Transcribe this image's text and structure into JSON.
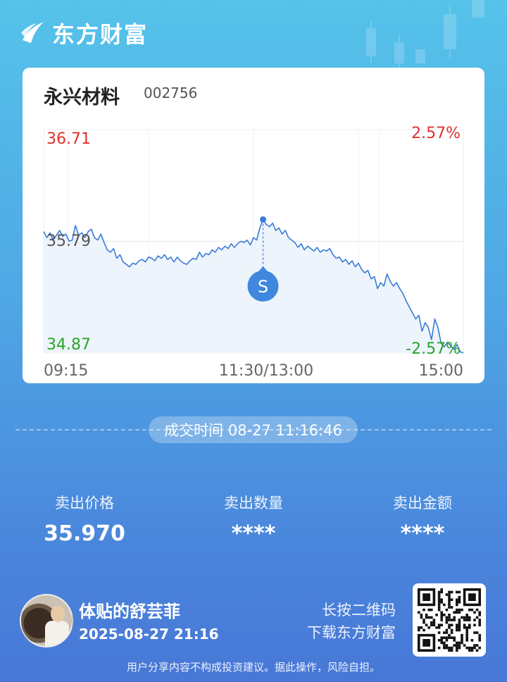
{
  "brand": {
    "name": "东方财富"
  },
  "stock": {
    "name": "永兴材料",
    "code": "002756"
  },
  "chart_data": {
    "type": "line",
    "y_high_label": "36.71",
    "y_mid_label": "35.79",
    "y_low_label": "34.87",
    "pct_high_label": "2.57%",
    "pct_low_label": "-2.57%",
    "x_labels": [
      "09:15",
      "11:30/13:00",
      "15:00"
    ],
    "ylim": [
      34.87,
      36.71
    ],
    "prev_close": 35.79,
    "marker": {
      "label": "S",
      "index": 69,
      "value": 35.97
    },
    "up_color": "#e03030",
    "down_color": "#2aa52a",
    "line_color": "#3a7dd6",
    "series": [
      {
        "values": [
          35.87,
          35.82,
          35.86,
          35.8,
          35.84,
          35.88,
          35.83,
          35.85,
          35.79,
          35.8,
          35.92,
          35.84,
          35.86,
          35.82,
          35.87,
          35.89,
          35.82,
          35.8,
          35.85,
          35.78,
          35.72,
          35.7,
          35.73,
          35.65,
          35.68,
          35.62,
          35.6,
          35.58,
          35.61,
          35.6,
          35.63,
          35.64,
          35.62,
          35.66,
          35.65,
          35.63,
          35.67,
          35.65,
          35.68,
          35.64,
          35.66,
          35.62,
          35.66,
          35.63,
          35.61,
          35.6,
          35.63,
          35.65,
          35.64,
          35.7,
          35.66,
          35.69,
          35.68,
          35.72,
          35.7,
          35.74,
          35.72,
          35.75,
          35.73,
          35.77,
          35.74,
          35.77,
          35.79,
          35.78,
          35.8,
          35.76,
          35.82,
          35.8,
          35.9,
          35.97,
          35.93,
          35.91,
          35.94,
          35.88,
          35.9,
          35.85,
          35.88,
          35.82,
          35.8,
          35.78,
          35.74,
          35.77,
          35.72,
          35.75,
          35.73,
          35.71,
          35.74,
          35.7,
          35.72,
          35.71,
          35.73,
          35.68,
          35.65,
          35.66,
          35.62,
          35.64,
          35.6,
          35.63,
          35.58,
          35.61,
          35.56,
          35.53,
          35.55,
          35.48,
          35.5,
          35.4,
          35.45,
          35.42,
          35.52,
          35.46,
          35.42,
          35.45,
          35.4,
          35.36,
          35.3,
          35.25,
          35.2,
          35.15,
          35.18,
          35.05,
          35.12,
          35.08,
          34.98,
          35.15,
          35.08,
          34.95,
          34.92,
          34.96,
          34.93,
          34.9,
          34.94,
          34.88,
          34.87
        ]
      }
    ]
  },
  "trade": {
    "time_label": "成交时间 08-27 11:16:46"
  },
  "stats": [
    {
      "label": "卖出价格",
      "value": "35.970"
    },
    {
      "label": "卖出数量",
      "value": "****"
    },
    {
      "label": "卖出金额",
      "value": "****"
    }
  ],
  "user": {
    "name": "体贴的舒芸菲",
    "time": "2025-08-27 21:16"
  },
  "qr": {
    "hint_line1": "长按二维码",
    "hint_line2": "下载东方财富"
  },
  "disclaimer": "用户分享内容不构成投资建议。据此操作，风险自担。"
}
